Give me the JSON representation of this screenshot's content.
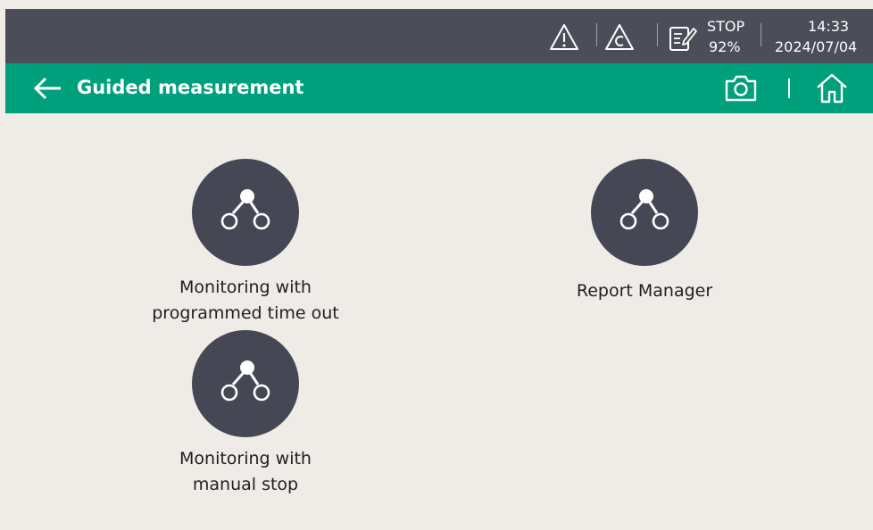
{
  "status_bar": {
    "mode_label": "STOP",
    "battery_percent": "92%",
    "time": "14:33",
    "date": "2024/07/04",
    "icons": [
      "warning-icon",
      "calibration-warning-icon",
      "edit-document-icon"
    ]
  },
  "header": {
    "title": "Guided measurement",
    "back_icon": "arrow-left-icon",
    "camera_icon": "camera-icon",
    "home_icon": "home-icon"
  },
  "tiles": [
    {
      "label_line1": "Monitoring with",
      "label_line2": "programmed time out",
      "icon": "workflow-icon"
    },
    {
      "label_line1": "Report Manager",
      "label_line2": "",
      "icon": "workflow-icon"
    },
    {
      "label_line1": "Monitoring with",
      "label_line2": "manual stop",
      "icon": "workflow-icon"
    }
  ],
  "colors": {
    "status_bar": "#4b4d59",
    "title_bar": "#00a07c",
    "background": "#efece8",
    "tile_circle": "#454854"
  }
}
